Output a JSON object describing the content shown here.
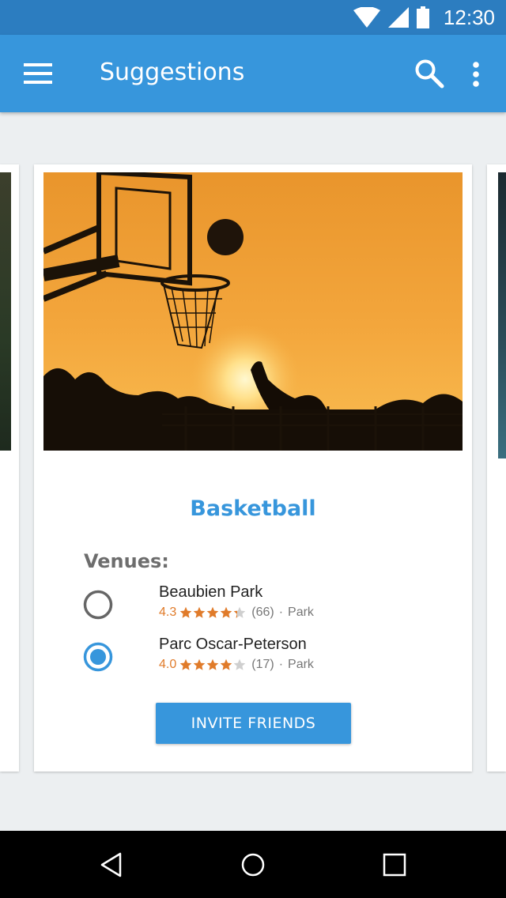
{
  "status_bar": {
    "time": "12:30",
    "icons": [
      "wifi-icon",
      "signal-icon",
      "battery-icon"
    ]
  },
  "app_bar": {
    "title": "Suggestions",
    "icons": [
      "menu-icon",
      "search-icon",
      "overflow-menu-icon"
    ]
  },
  "card": {
    "image": "basketball-sunset-photo",
    "title": "Basketball",
    "venues_label": "Venues:",
    "venues": [
      {
        "name": "Beaubien Park",
        "rating": "4.3",
        "rating_value": 4.3,
        "reviews": "(66)",
        "separator": "·",
        "category": "Park",
        "selected": false
      },
      {
        "name": "Parc Oscar-Peterson",
        "rating": "4.0",
        "rating_value": 4.0,
        "reviews": "(17)",
        "separator": "·",
        "category": "Park",
        "selected": true
      }
    ],
    "invite_button": "INVITE FRIENDS"
  },
  "nav_bar": {
    "icons": [
      "back-icon",
      "home-icon",
      "recents-icon"
    ]
  },
  "colors": {
    "status_bar": "#2C7DC0",
    "app_bar": "#3796DC",
    "accent": "#3796DC",
    "rating": "#E07B2A",
    "background": "#ECEFF1"
  }
}
